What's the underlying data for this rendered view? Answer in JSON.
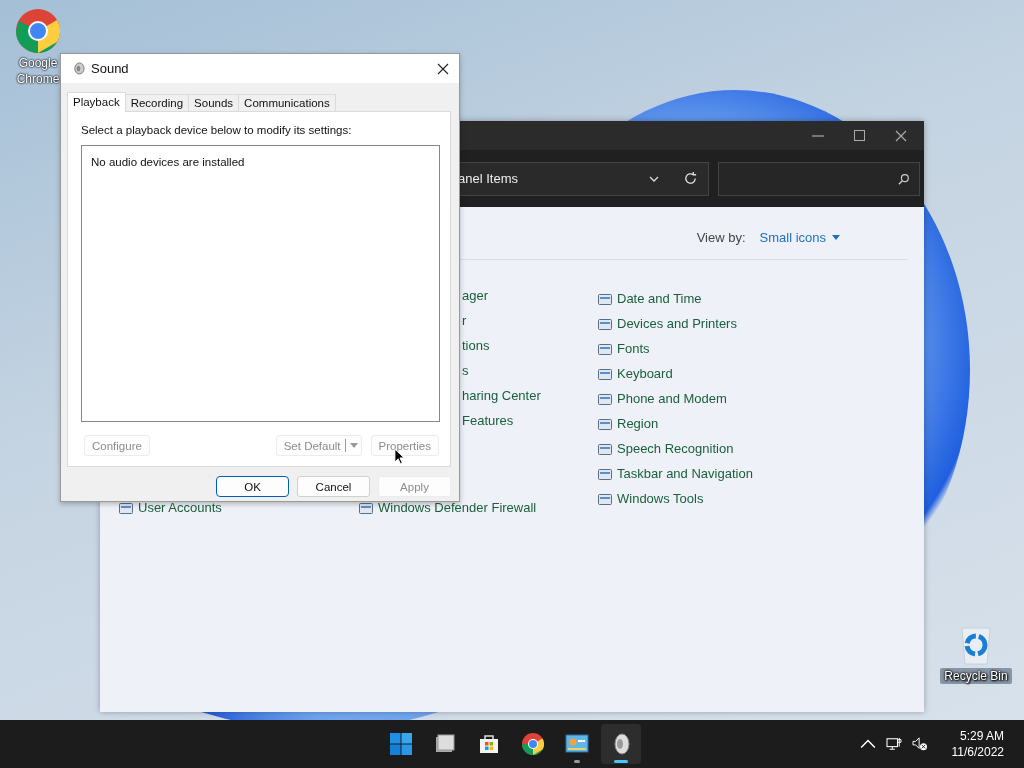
{
  "desktop_icons": [
    {
      "label": "Google Chrome",
      "kind": "browser"
    },
    {
      "label": "Recycle Bin",
      "kind": "recycle"
    }
  ],
  "control_panel": {
    "address": "anel Items",
    "view_by_label": "View by:",
    "view_by_value": "Small icons",
    "column_1": [
      "ager",
      "r",
      "tions",
      "s",
      "haring Center",
      "Features"
    ],
    "column_2": [
      "Date and Time",
      "Devices and Printers",
      "Fonts",
      "Keyboard",
      "Phone and Modem",
      "Region",
      "Speech Recognition",
      "Taskbar and Navigation",
      "Windows Tools"
    ],
    "bottom_row": [
      "User Accounts",
      "Windows Defender Firewall"
    ]
  },
  "sound_dialog": {
    "title": "Sound",
    "tabs": [
      {
        "label": "Playback",
        "selected": true
      },
      {
        "label": "Recording",
        "selected": false
      },
      {
        "label": "Sounds",
        "selected": false
      },
      {
        "label": "Communications",
        "selected": false
      }
    ],
    "instruction": "Select a playback device below to modify its settings:",
    "device_list_message": "No audio devices are installed",
    "device_buttons": [
      {
        "label": "Configure",
        "kind": "plain",
        "disabled": true
      },
      {
        "label": "Set Default",
        "kind": "split",
        "disabled": true
      },
      {
        "label": "Properties",
        "kind": "plain",
        "disabled": true
      }
    ],
    "dialog_buttons": [
      {
        "label": "OK",
        "default": true,
        "disabled": false
      },
      {
        "label": "Cancel",
        "default": false,
        "disabled": false
      },
      {
        "label": "Apply",
        "default": false,
        "disabled": true
      }
    ]
  },
  "taskbar": {
    "apps": [
      {
        "kind": "start",
        "running": false,
        "active": false
      },
      {
        "kind": "files",
        "running": false,
        "active": false
      },
      {
        "kind": "store",
        "running": false,
        "active": false
      },
      {
        "kind": "browser",
        "running": false,
        "active": false
      },
      {
        "kind": "control-panel",
        "running": true,
        "active": false
      },
      {
        "kind": "sound",
        "running": true,
        "active": true
      }
    ],
    "time": "5:29 AM",
    "date": "11/6/2022"
  }
}
